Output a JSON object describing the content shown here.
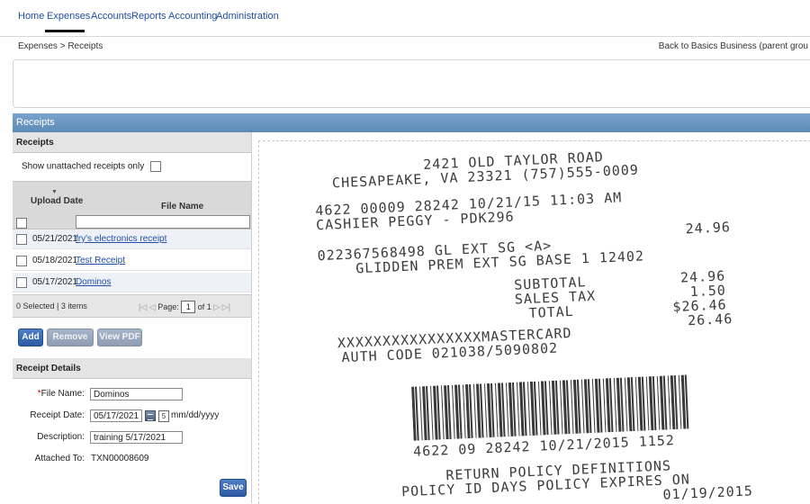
{
  "nav": {
    "items": [
      "Home",
      "Expenses",
      "Accounts",
      "Reports",
      "Accounting",
      "Administration"
    ],
    "active": "Expenses"
  },
  "breadcrumb": "Expenses > Receipts",
  "organization": "Back to Basics Business (parent grou",
  "band_title": "Receipts",
  "receipts_panel": {
    "header": "Receipts",
    "show_unattached_label": "Show unattached receipts only",
    "columns": {
      "upload_date": "Upload Date",
      "file_name": "File Name"
    },
    "rows": [
      {
        "date": "05/21/2021",
        "file": "fry's electronics receipt"
      },
      {
        "date": "05/18/2021",
        "file": "Test Receipt"
      },
      {
        "date": "05/17/2021",
        "file": "Dominos"
      }
    ],
    "pager": {
      "selection": "0 Selected | 3 items",
      "page_label": "Page:",
      "page": "1",
      "of": "of 1"
    },
    "buttons": {
      "add": "Add",
      "remove": "Remove",
      "view_pdf": "View PDF"
    }
  },
  "details": {
    "header": "Receipt Details",
    "file_name_label": "File Name:",
    "file_name_value": "Dominos",
    "receipt_date_label": "Receipt Date:",
    "receipt_date_value": "05/17/2021",
    "date_format": "mm/dd/yyyy",
    "description_label": "Description:",
    "description_value": "training 5/17/2021",
    "attached_to_label": "Attached To:",
    "attached_to_value": "TXN00008609",
    "save": "Save"
  },
  "receipt": {
    "lines": [
      "2421 OLD TAYLOR ROAD",
      "CHESAPEAKE, VA 23321  (757)555-0009",
      "4622  00009  28242     10/21/15  11:03 AM",
      "CASHIER PEGGY - PDK296",
      "24.96",
      "022367568498 GL EXT SG <A>",
      "GLIDDEN PREM EXT SG BASE 1 12402",
      "SUBTOTAL",
      "24.96",
      "SALES TAX",
      "1.50",
      "TOTAL",
      "$26.46",
      "XXXXXXXXXXXXXXXXMASTERCARD",
      "26.46",
      "AUTH CODE 021038/5090802",
      "4622 09 28242 10/21/2015 1152",
      "RETURN POLICY DEFINITIONS",
      "POLICY ID   DAYS   POLICY EXPIRES ON",
      "01/19/2015"
    ]
  }
}
